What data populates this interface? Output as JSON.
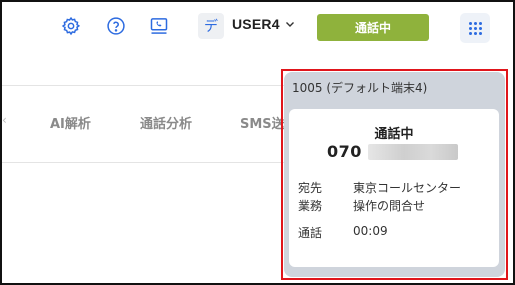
{
  "header": {
    "avatar_char": "デ",
    "user_name": "USER4",
    "call_status_button": "通話中",
    "icons": [
      "gear-icon",
      "help-icon",
      "softphone-icon",
      "chevron-down-icon",
      "apps-grid-icon"
    ]
  },
  "tabs": [
    "AI解析",
    "通話分析",
    "SMS送"
  ],
  "call_popup": {
    "title": "1005 (デフォルト端末4)",
    "status": "通話中",
    "phone_prefix": "070",
    "fields": [
      {
        "label": "宛先",
        "value": "東京コールセンター"
      },
      {
        "label": "業務",
        "value": "操作の問合せ"
      },
      {
        "label": "通話",
        "value": "00:09"
      }
    ]
  },
  "colors": {
    "accent_blue": "#2d6be0",
    "call_button_green": "#8fb23c",
    "highlight_red": "#e0151b",
    "popup_gray": "#cfd4dc"
  }
}
